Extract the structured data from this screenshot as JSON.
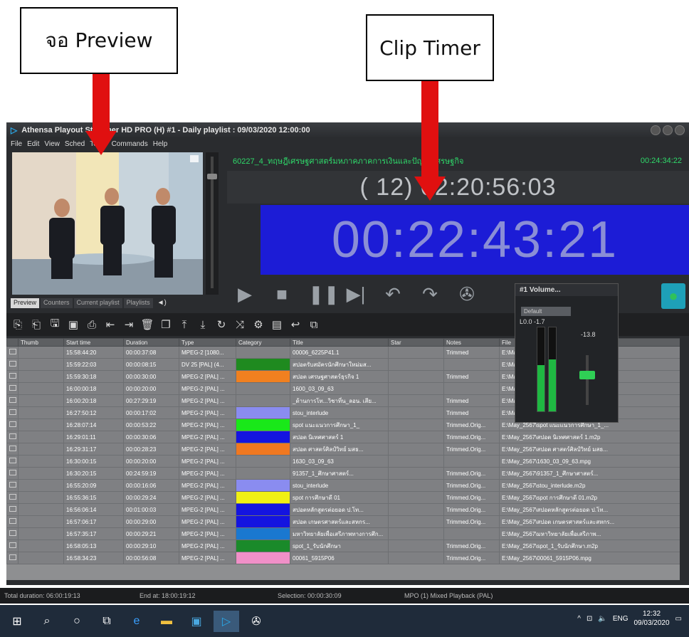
{
  "callouts": {
    "preview": "จอ Preview",
    "clip_timer": "Clip Timer"
  },
  "window": {
    "title": "Athensa Playout Streamer HD PRO (H) #1 - Daily playlist : 09/03/2020 12:00:00"
  },
  "menu": [
    "File",
    "Edit",
    "View",
    "Sched",
    "Tools",
    "Commands",
    "Help"
  ],
  "preview_tabs": [
    "Preview",
    "Counters",
    "Current playlist",
    "Playlists"
  ],
  "clip": {
    "title": "60227_4_ทฤษฎีเศรษฐศาสตร์มหภาคภาคการเงินและปัญหาเศรษฐกิจ",
    "remaining": "00:24:34:22",
    "countdown": "( 12) 02:20:56:03",
    "timer": "00:22:43:21"
  },
  "transport_icons": [
    "play-icon",
    "stop-icon",
    "pause-icon",
    "next-icon",
    "undo-icon",
    "redo-icon",
    "reel-icon"
  ],
  "volume": {
    "title": "#1 Volume...",
    "preset": "Default",
    "levels": "L0.0 -1.7",
    "gain": "-13.8",
    "meter_left": 0.55,
    "meter_right": 0.62
  },
  "toolbar_icons": [
    "insert-icon",
    "insert-after-icon",
    "save-icon",
    "save-as-icon",
    "load-icon",
    "align-left-icon",
    "align-right-icon",
    "delete-icon",
    "copy-icon",
    "move-top-icon",
    "move-bottom-icon",
    "loop-icon",
    "shuffle-icon",
    "settings-icon",
    "screen-icon",
    "back-icon",
    "window-icon"
  ],
  "playlist": {
    "columns": [
      "",
      "Thumb",
      "Start time",
      "Duration",
      "Type",
      "Category",
      "Title",
      "Star",
      "Notes",
      "File"
    ],
    "rows": [
      {
        "start": "15:58:44:20",
        "dur": "00:00:37:08",
        "type": "MPEG-2 [1080...",
        "cat": "",
        "title": "00006_6225P41.1",
        "notes": "Trimmed",
        "file": "E:\\May_2567\\6225P41.1.MXF"
      },
      {
        "start": "15:59:22:03",
        "dur": "00:00:08:15",
        "type": "DV 25 [PAL] (4...",
        "cat": "#1f8a1f",
        "title": "สปอตรับสมัครนักศึกษาใหม่มส...",
        "notes": "",
        "file": "E:\\May_2567\\สมัครนักศึกษาใหม่มส..."
      },
      {
        "start": "15:59:30:18",
        "dur": "00:00:30:00",
        "type": "MPEG-2 [PAL] ...",
        "cat": "#f08020",
        "title": "สปอต เศรษฐศาสตร์ธุรกิจ 1",
        "notes": "Trimmed",
        "file": "E:\\May_2567\\เศรษฐศาสตร์ธุรกิจ..."
      },
      {
        "start": "16:00:00:18",
        "dur": "00:00:20:00",
        "type": "MPEG-2 [PAL] ...",
        "cat": "",
        "title": "1600_03_09_63",
        "notes": "",
        "file": "E:\\May_2567\\1600_03_09_63.mpg"
      },
      {
        "start": "16:00:20:18",
        "dur": "00:27:29:19",
        "type": "MPEG-2 [PAL] ...",
        "cat": "",
        "title": "_ด้านการโท...วิชาที่น_ลอน. เสีย...",
        "notes": "Trimmed",
        "file": "E:\\May_2567\\...วิชาที่น_ลอน. เสีย..."
      },
      {
        "start": "16:27:50:12",
        "dur": "00:00:17:02",
        "type": "MPEG-2 [PAL] ...",
        "cat": "#8a8cf0",
        "title": "stou_interlude",
        "notes": "Trimmed",
        "file": "E:\\May_2567\\stou_interlude.m2p"
      },
      {
        "start": "16:28:07:14",
        "dur": "00:00:53:22",
        "type": "MPEG-2 [PAL] ...",
        "cat": "#19e819",
        "title": "spot แนะแนวการศึกษา_1_",
        "notes": "Trimmed.Orig...",
        "file": "E:\\May_2567\\spot แนะแนวการศึกษา_1_..."
      },
      {
        "start": "16:29:01:11",
        "dur": "00:00:30:06",
        "type": "MPEG-2 [PAL] ...",
        "cat": "#1414e0",
        "title": "สปอต นิเทศศาสตร์ 1",
        "notes": "Trimmed.Orig...",
        "file": "E:\\May_2567\\สปอต นิเทศศาสตร์ 1.m2p"
      },
      {
        "start": "16:29:31:17",
        "dur": "00:00:28:23",
        "type": "MPEG-2 [PAL] ...",
        "cat": "#f07820",
        "title": "สปอต ศาสตร์ศิลป์วิทย์ มสธ...",
        "notes": "Trimmed.Orig...",
        "file": "E:\\May_2567\\สปอต ศาสตร์ศิลป์วิทย์ มสธ..."
      },
      {
        "start": "16:30:00:15",
        "dur": "00:00:20:00",
        "type": "MPEG-2 [PAL] ...",
        "cat": "",
        "title": "1630_03_09_63",
        "notes": "",
        "file": "E:\\May_2567\\1630_03_09_63.mpg"
      },
      {
        "start": "16:30:20:15",
        "dur": "00:24:59:19",
        "type": "MPEG-2 [PAL] ...",
        "cat": "",
        "title": "91357_1_ศึกษาศาสตร์...",
        "notes": "Trimmed.Orig...",
        "file": "E:\\May_2567\\91357_1_ศึกษาศาสตร์..."
      },
      {
        "start": "16:55:20:09",
        "dur": "00:00:16:06",
        "type": "MPEG-2 [PAL] ...",
        "cat": "#8a8cf0",
        "title": "stou_interlude",
        "notes": "Trimmed.Orig...",
        "file": "E:\\May_2567\\stou_interlude.m2p"
      },
      {
        "start": "16:55:36:15",
        "dur": "00:00:29:24",
        "type": "MPEG-2 [PAL] ...",
        "cat": "#f0f014",
        "title": "spot การศึกษาดี 01",
        "notes": "Trimmed.Orig...",
        "file": "E:\\May_2567\\spot การศึกษาดี 01.m2p"
      },
      {
        "start": "16:56:06:14",
        "dur": "00:01:00:03",
        "type": "MPEG-2 [PAL] ...",
        "cat": "#1414e0",
        "title": "สปอตหลักสูตรต่อยอด ป.โท...",
        "notes": "Trimmed.Orig...",
        "file": "E:\\May_2567\\สปอตหลักสูตรต่อยอด ป.โท..."
      },
      {
        "start": "16:57:06:17",
        "dur": "00:00:29:00",
        "type": "MPEG-2 [PAL] ...",
        "cat": "#1414e0",
        "title": "สปอต เกษตรศาสตร์และสหกร...",
        "notes": "Trimmed.Orig...",
        "file": "E:\\May_2567\\สปอต เกษตรศาสตร์และสหกร..."
      },
      {
        "start": "16:57:35:17",
        "dur": "00:00:29:21",
        "type": "MPEG-2 [PAL] ...",
        "cat": "#1a78d0",
        "title": "มหาวิทยาลัยเพื่อเสรีภาพทางการศึก...",
        "notes": "",
        "file": "E:\\May_2567\\มหาวิทยาลัยเพื่อเสรีภาพ..."
      },
      {
        "start": "16:58:05:13",
        "dur": "00:00:29:10",
        "type": "MPEG-2 [PAL] ...",
        "cat": "#1a8a2a",
        "title": "spot_1_รับนักศึกษา",
        "notes": "Trimmed.Orig...",
        "file": "E:\\May_2567\\spot_1_รับนักศึกษา.m2p"
      },
      {
        "start": "16:58:34:23",
        "dur": "00:00:56:08",
        "type": "MPEG-2 [PAL] ...",
        "cat": "#f090c8",
        "title": "00061_5915P06",
        "notes": "Trimmed.Orig...",
        "file": "E:\\May_2567\\00061_5915P06.mpg"
      }
    ]
  },
  "status": {
    "total": "Total duration: 06:00:19:13",
    "end": "End at: 18:00:19:12",
    "selection": "Selection: 00:00:30:09",
    "mode": "MPO (1) Mixed Playback (PAL)"
  },
  "taskbar": {
    "icons": [
      "windows-icon",
      "search-icon",
      "cortana-icon",
      "task-view-icon",
      "edge-icon",
      "file-explorer-icon",
      "app-icon",
      "playout-icon",
      "app2-icon"
    ],
    "lang": "ENG",
    "time": "12:32",
    "date": "09/03/2020"
  }
}
